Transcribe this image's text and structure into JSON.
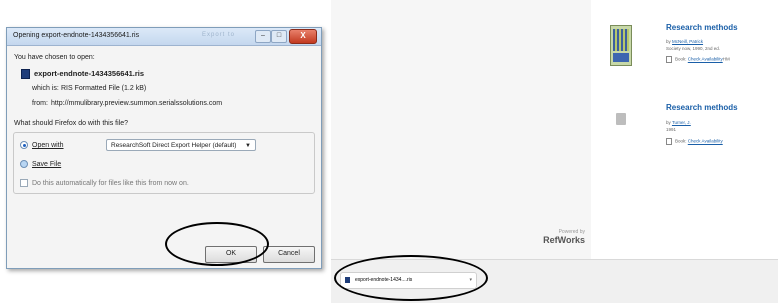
{
  "dialog": {
    "title": "Opening export-endnote-1434356641.ris",
    "title_ghost": "Export to",
    "minimize": "–",
    "maximize": "□",
    "close": "X",
    "chosen_label": "You have chosen to open:",
    "filename": "export-endnote-1434356641.ris",
    "which_is_label": "which is:",
    "which_is_value": "RIS Formatted File (1.2 kB)",
    "from_label": "from:",
    "from_value": "http://mmulibrary.preview.summon.serialssolutions.com",
    "question": "What should Firefox do with this file?",
    "open_with_label": "Open with",
    "open_with_app": "ResearchSoft Direct Export Helper (default)",
    "save_file_label": "Save File",
    "auto_label": "Do this automatically for files like this from now on.",
    "ok_label": "OK",
    "cancel_label": "Cancel"
  },
  "sidebar": {
    "powered_by": "Powered by",
    "brand": "RefWorks"
  },
  "results": [
    {
      "title": "Research methods",
      "by_prefix": "by",
      "author": "McNeill, Patrick",
      "pub": "Society now, 1990, 2nd ed.",
      "format_prefix": "Book:",
      "availability": "Check Availability",
      "extra": "HM"
    },
    {
      "title": "Research methods",
      "by_prefix": "by",
      "author": "Turner, J.",
      "pub": "1991",
      "format_prefix": "Book:",
      "availability": "Check Availability",
      "extra": ""
    }
  ],
  "download_bar": {
    "item": "export-endnote-1434....ris",
    "caret": "▾"
  }
}
